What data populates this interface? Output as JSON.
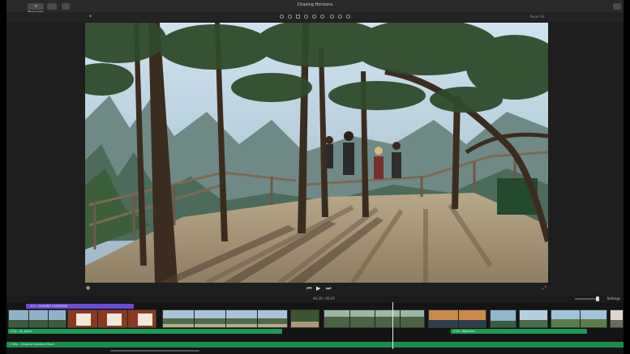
{
  "window": {
    "back_label": "< Projects",
    "title": "Chasing Horizons",
    "share_icon": "share-icon"
  },
  "toolbar": {
    "reset_label": "Reset All",
    "tools": [
      "color-balance-icon",
      "color-correction-icon",
      "crop-icon",
      "stabilization-icon",
      "volume-icon",
      "noise-reduction-icon",
      "speed-icon",
      "filter-icon",
      "info-icon"
    ]
  },
  "controls": {
    "previous_icon": "skip-back-icon",
    "play_icon": "play-icon",
    "next_icon": "skip-forward-icon"
  },
  "timeline": {
    "timecode": "00:26 / 00:45",
    "settings_label": "Settings",
    "title_clip_label": "4.0 - CHASING HORIZONS",
    "audio_clips": [
      {
        "label": "2.5s - Ali_piano"
      },
      {
        "label": "4.0s - Waterfall"
      }
    ],
    "music_label": "1.08m - Chasing Horizons Music"
  },
  "colors": {
    "title_clip": "#6b4bd6",
    "audio_clip": "#1f9a55"
  }
}
